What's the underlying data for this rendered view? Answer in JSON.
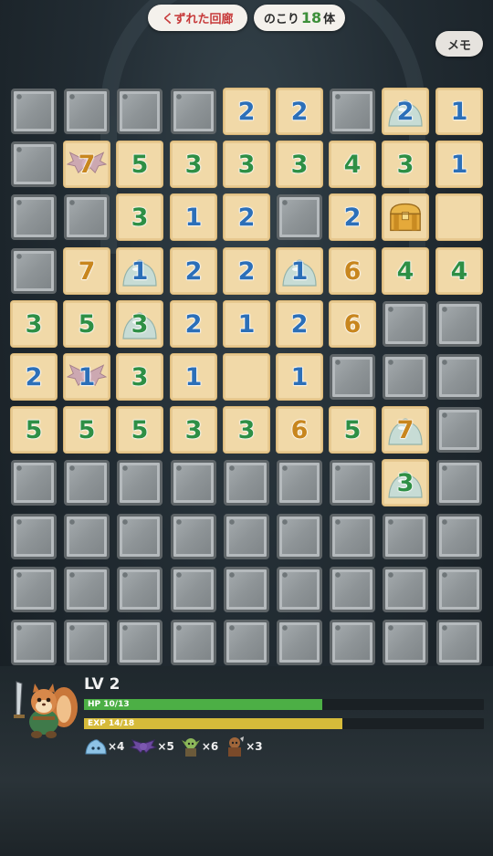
{
  "header": {
    "floor_name": "くずれた回廊",
    "remaining_prefix": "のこり",
    "remaining_count": "18",
    "remaining_suffix": "体",
    "memo_label": "メモ"
  },
  "board": {
    "columns": 9,
    "rows": 11,
    "cells": [
      [
        "#",
        "#",
        "#",
        "#",
        "2",
        "2",
        "#",
        "S2",
        "1"
      ],
      [
        "#",
        "B7",
        "5",
        "3",
        "3",
        "3",
        "4",
        "3",
        "1"
      ],
      [
        "#",
        "#",
        "3",
        "1",
        "2",
        "#",
        "2",
        "T",
        ""
      ],
      [
        "#",
        "7",
        "S1",
        "2",
        "2",
        "S1",
        "6",
        "4",
        "4"
      ],
      [
        "3",
        "5",
        "S3",
        "2",
        "1",
        "2",
        "6",
        "#",
        "#"
      ],
      [
        "2",
        "B1",
        "3",
        "1",
        "",
        "1",
        "#",
        "#",
        "#"
      ],
      [
        "5",
        "5",
        "5",
        "3",
        "3",
        "6",
        "5",
        "S7",
        "#"
      ],
      [
        "#",
        "#",
        "#",
        "#",
        "#",
        "#",
        "#",
        "S3",
        "#"
      ],
      [
        "#",
        "#",
        "#",
        "#",
        "#",
        "#",
        "#",
        "#",
        "#"
      ],
      [
        "#",
        "#",
        "#",
        "#",
        "#",
        "#",
        "#",
        "#",
        "#"
      ],
      [
        "#",
        "#",
        "#",
        "#",
        "#",
        "#",
        "#",
        "#",
        "#"
      ]
    ]
  },
  "status": {
    "level_label": "LV 2",
    "hp_text": "HP 10/13",
    "hp_current": 10,
    "hp_max": 13,
    "exp_text": "EXP 14/18",
    "exp_current": 14,
    "exp_max": 18
  },
  "kills": [
    {
      "icon": "slime-icon",
      "count": "×4"
    },
    {
      "icon": "bat-icon",
      "count": "×5"
    },
    {
      "icon": "goblin-icon",
      "count": "×6"
    },
    {
      "icon": "orc-icon",
      "count": "×3"
    }
  ],
  "colors": {
    "revealed_tile": "#f1d9a8",
    "covered_tile": "#8e9497",
    "hp_bar": "#4caf45",
    "exp_bar": "#d6bb3a",
    "floor_name": "#c73a3a",
    "remaining_count": "#3d8f3a"
  }
}
